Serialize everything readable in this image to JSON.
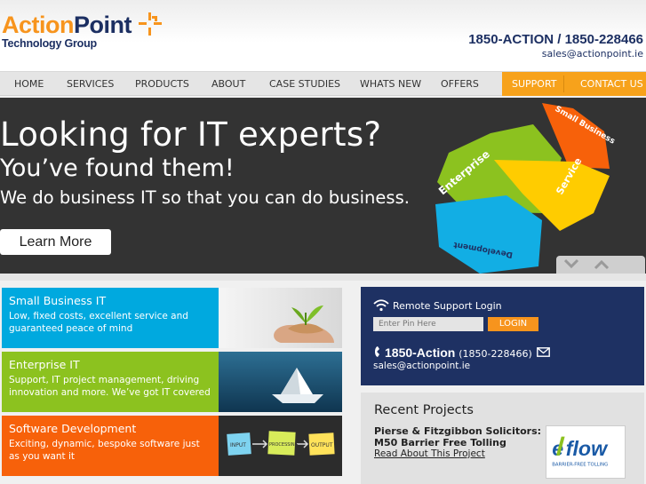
{
  "brand": {
    "logo_action": "Action",
    "logo_point": "Point",
    "logo_sub": "Technology Group",
    "orange": "#f7941d",
    "navy": "#1c2f62"
  },
  "contact": {
    "phones": "1850-ACTION / 1850-228466",
    "email": "sales@actionpoint.ie"
  },
  "nav": {
    "items": [
      "HOME",
      "SERVICES",
      "PRODUCTS",
      "ABOUT",
      "CASE STUDIES",
      "WHATS NEW",
      "OFFERS"
    ],
    "support": "SUPPORT",
    "contact": "CONTACT US"
  },
  "hero": {
    "headline": "Looking for IT experts?",
    "subhead": "You’ve found them!",
    "tagline": "We do business IT so that you can do business.",
    "cta": "Learn More",
    "pie_labels": [
      "Small Business",
      "Enterprise",
      "Service",
      "Development"
    ]
  },
  "services": [
    {
      "title": "Small Business IT",
      "desc": "Low, fixed costs, excellent service and guaranteed peace of mind",
      "color": "#00a9df"
    },
    {
      "title": "Enterprise IT",
      "desc": "Support, IT project management, driving innovation and more. We’ve got IT covered",
      "color": "#8cc21f"
    },
    {
      "title": "Software Development",
      "desc": "Exciting, dynamic, bespoke software just as you want it",
      "color": "#f7610a"
    }
  ],
  "process_notes": [
    "INPUT",
    "PROCESSING",
    "OUTPUT"
  ],
  "support_box": {
    "remote_label": "Remote Support Login",
    "pin_placeholder": "Enter Pin Here",
    "login": "LOGIN",
    "phone_word": "1850-Action",
    "phone_num": "(1850-228466)",
    "email": "sales@actionpoint.ie"
  },
  "recent": {
    "title": "Recent Projects",
    "item_line1": "Pierse & Fitzgibbon Solicitors:",
    "item_line2": "M50 Barrier Free Tolling",
    "link": "Read About This Project",
    "logo_e": "e",
    "logo_flow": "flow",
    "logo_sub": "BARRIER-FREE TOLLING"
  }
}
